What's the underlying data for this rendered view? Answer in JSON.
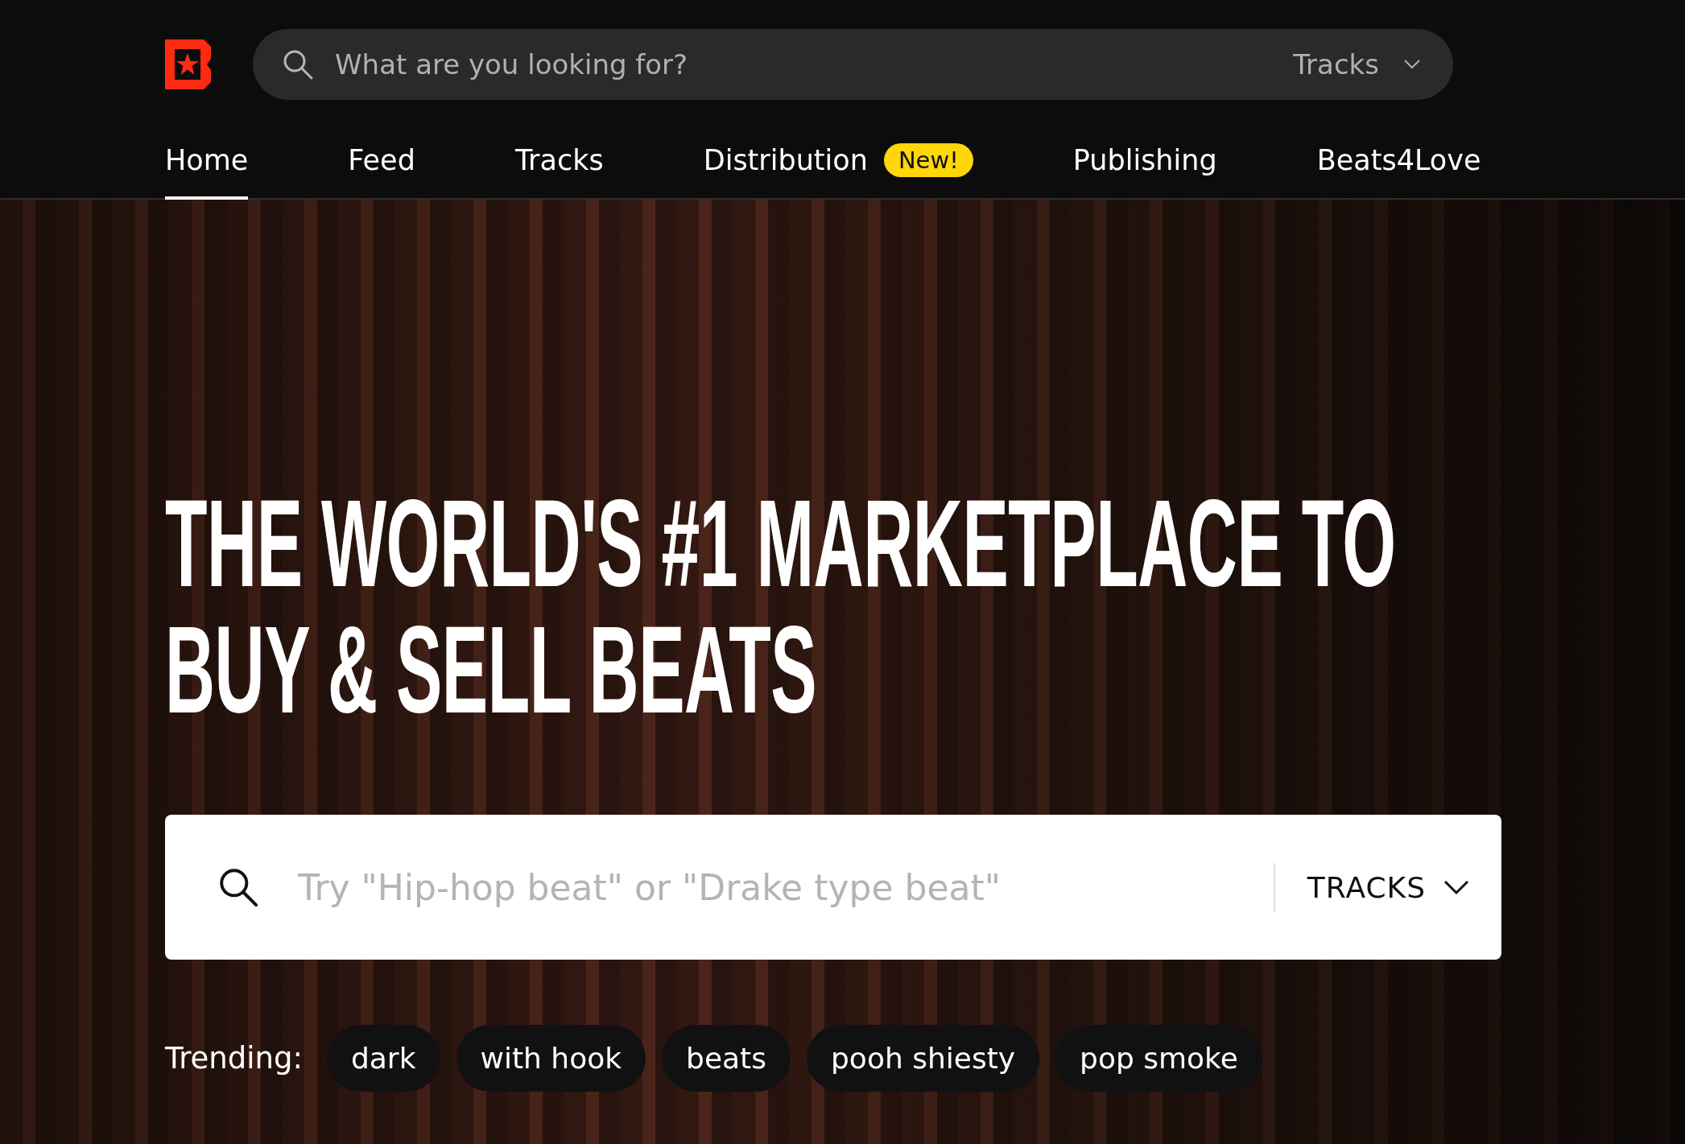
{
  "header": {
    "search": {
      "placeholder": "What are you looking for?",
      "category": "Tracks"
    },
    "nav": [
      {
        "label": "Home",
        "selected": true
      },
      {
        "label": "Feed",
        "selected": false
      },
      {
        "label": "Tracks",
        "selected": false
      },
      {
        "label": "Distribution",
        "selected": false,
        "badge": "New!"
      },
      {
        "label": "Publishing",
        "selected": false
      },
      {
        "label": "Beats4Love",
        "selected": false
      }
    ]
  },
  "hero": {
    "headline_lines": [
      "THE WORLD'S #1 MARKETPLACE TO",
      "BUY & SELL BEATS"
    ],
    "search": {
      "placeholder": "Try \"Hip-hop beat\" or \"Drake type beat\"",
      "category": "TRACKS"
    },
    "trending_label": "Trending:",
    "trending": [
      "dark",
      "with hook",
      "beats",
      "pooh shiesty",
      "pop smoke"
    ]
  }
}
